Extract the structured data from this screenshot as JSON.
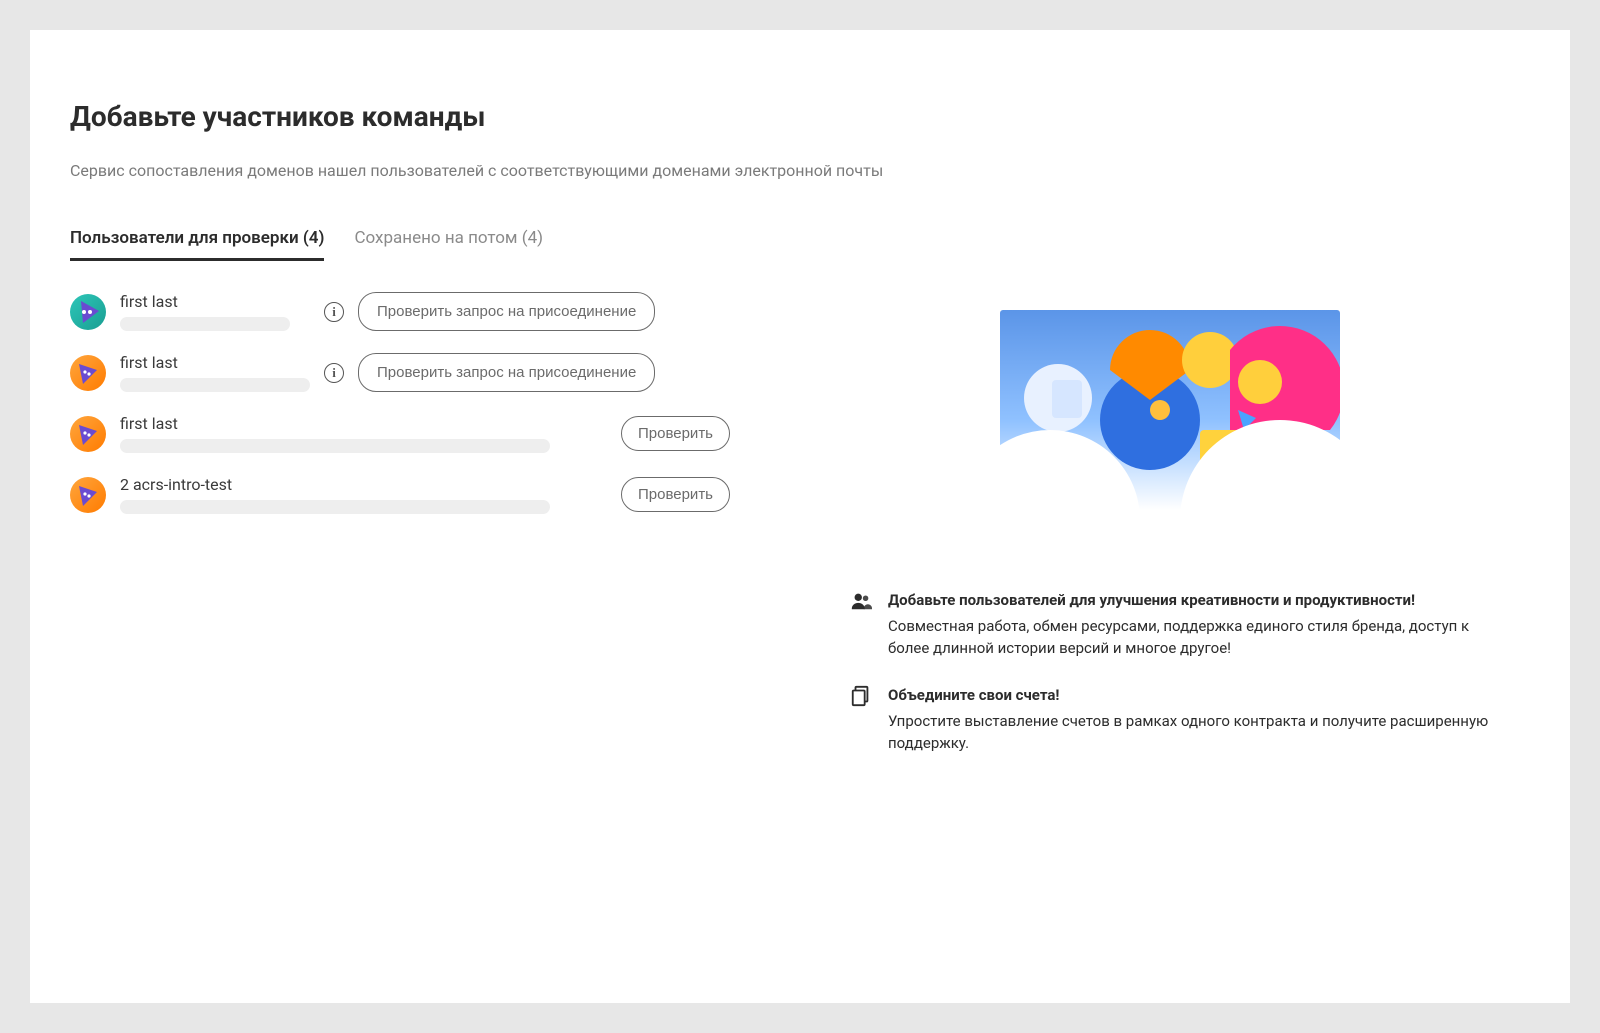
{
  "header": {
    "title": "Добавьте участников команды",
    "subtitle": "Сервис сопоставления доменов нашел пользователей с соответствующими доменами электронной почты"
  },
  "tabs": {
    "review": {
      "label": "Пользователи для проверки (4)"
    },
    "saved": {
      "label": "Сохранено на потом (4)"
    }
  },
  "buttons": {
    "review_request": "Проверить запрос на присоединение",
    "review": "Проверить"
  },
  "users": [
    {
      "name": "first last"
    },
    {
      "name": "first last"
    },
    {
      "name": "first last"
    },
    {
      "name": "2 acrs-intro-test"
    }
  ],
  "benefits": [
    {
      "title": "Добавьте пользователей для улучшения креативности и продуктивности!",
      "desc": "Совместная работа, обмен ресурсами, поддержка единого стиля бренда, доступ к более длинной истории версий и многое другое!"
    },
    {
      "title": "Объедините свои счета!",
      "desc": "Упростите выставление счетов в рамках одного контракта и получите расширенную поддержку."
    }
  ]
}
